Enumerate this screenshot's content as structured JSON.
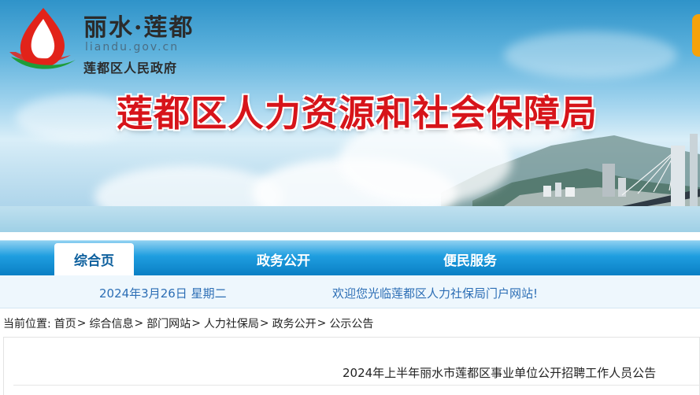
{
  "header": {
    "site_name": "丽水·莲都",
    "domain": "liandu.gov.cn",
    "government": "莲都区人民政府",
    "bureau_title": "莲都区人力资源和社会保障局",
    "logo_icon": "liandu-lotus-logo",
    "colors": {
      "title_red": "#d7141a",
      "logo_red": "#e2231a",
      "logo_green": "#1f9c3a"
    }
  },
  "nav": {
    "items": [
      {
        "label": "综合页",
        "active": true
      },
      {
        "label": "政务公开",
        "active": false
      },
      {
        "label": "便民服务",
        "active": false
      }
    ],
    "colors": {
      "bar": "#1f9ee0",
      "active_text": "#0c5f9d"
    }
  },
  "info_bar": {
    "date": "2024年3月26日 星期二",
    "welcome": "欢迎您光临莲都区人力社保局门户网站!"
  },
  "breadcrumb": {
    "prefix": "当前位置:",
    "items": [
      "首页",
      "综合信息",
      "部门网站",
      "人力社保局",
      "政务公开",
      "公示公告"
    ],
    "separator": ">"
  },
  "article": {
    "title": "2024年上半年丽水市莲都区事业单位公开招聘工作人员公告"
  }
}
